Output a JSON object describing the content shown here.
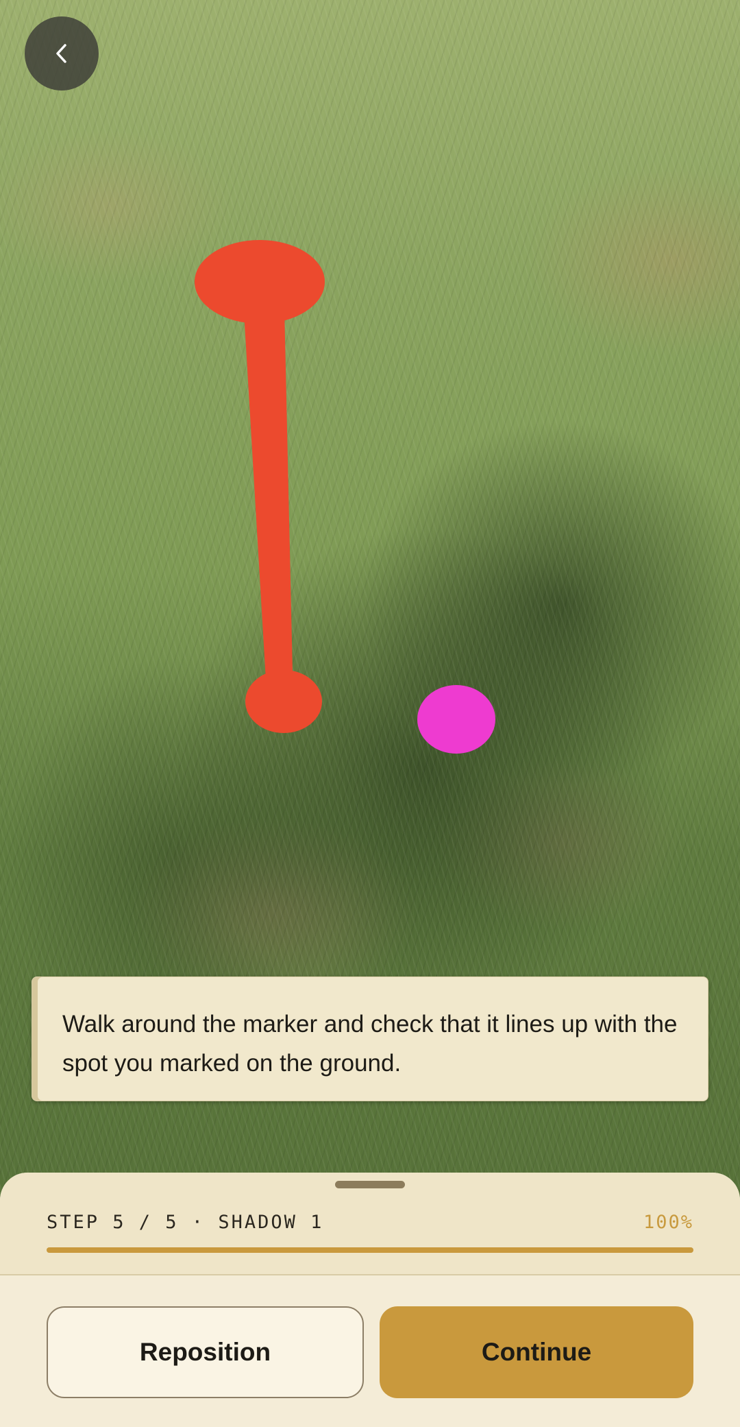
{
  "header": {
    "back_icon": "chevron-left-icon"
  },
  "ar_overlay": {
    "marker_color": "#ec4a2e",
    "ground_spot_color": "#ee3bd0"
  },
  "instruction": {
    "text": "Walk around the marker and check that it lines up with the spot you marked on the ground."
  },
  "progress": {
    "step_label": "STEP 5 / 5 · SHADOW 1",
    "percent_label": "100%",
    "fraction": 1.0,
    "color": "#c9993d"
  },
  "actions": {
    "reposition_label": "Reposition",
    "continue_label": "Continue"
  }
}
